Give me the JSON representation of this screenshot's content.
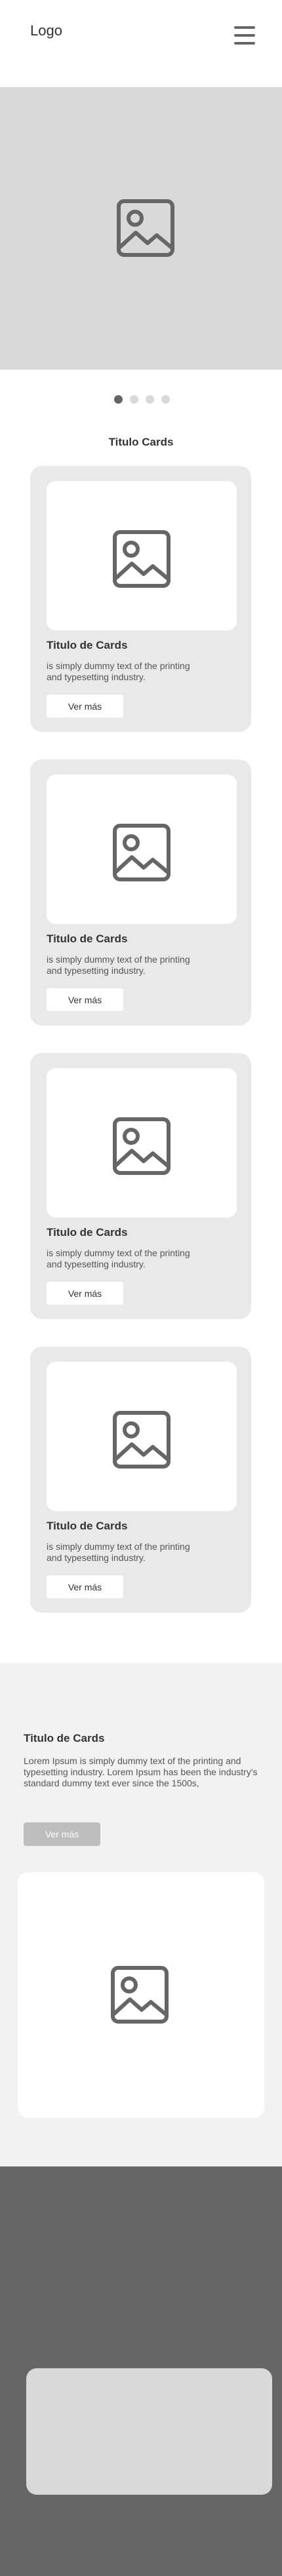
{
  "header": {
    "logo": "Logo",
    "menu_icon": "hamburger-menu-icon"
  },
  "hero": {
    "icon": "image-placeholder-icon"
  },
  "carousel": {
    "dot_count": 4,
    "active_index": 0
  },
  "cards_section": {
    "title": "Titulo Cards",
    "cards": [
      {
        "title": "Titulo de Cards",
        "text": "is simply dummy text of the printing and typesetting industry.",
        "button": "Ver más",
        "icon": "image-placeholder-icon"
      },
      {
        "title": "Titulo de Cards",
        "text": "is simply dummy text of the printing and typesetting industry.",
        "button": "Ver más",
        "icon": "image-placeholder-icon"
      },
      {
        "title": "Titulo de Cards",
        "text": "is simply dummy text of the printing and typesetting industry.",
        "button": "Ver más",
        "icon": "image-placeholder-icon"
      },
      {
        "title": "Titulo de Cards",
        "text": "is simply dummy text of the printing and typesetting industry.",
        "button": "Ver más",
        "icon": "image-placeholder-icon"
      }
    ]
  },
  "info": {
    "title": "Titulo de Cards",
    "text": "Lorem Ipsum is simply dummy text of the printing and typesetting industry. Lorem Ipsum has been the industry's standard dummy text ever since the 1500s,",
    "button": "Ver más",
    "icon": "image-placeholder-icon"
  },
  "colors": {
    "placeholder_gray": "#d9d9d9",
    "card_bg": "#e9e9e9",
    "section_bg": "#f2f2f2",
    "footer_bg": "#666666",
    "icon_stroke": "#666666"
  }
}
